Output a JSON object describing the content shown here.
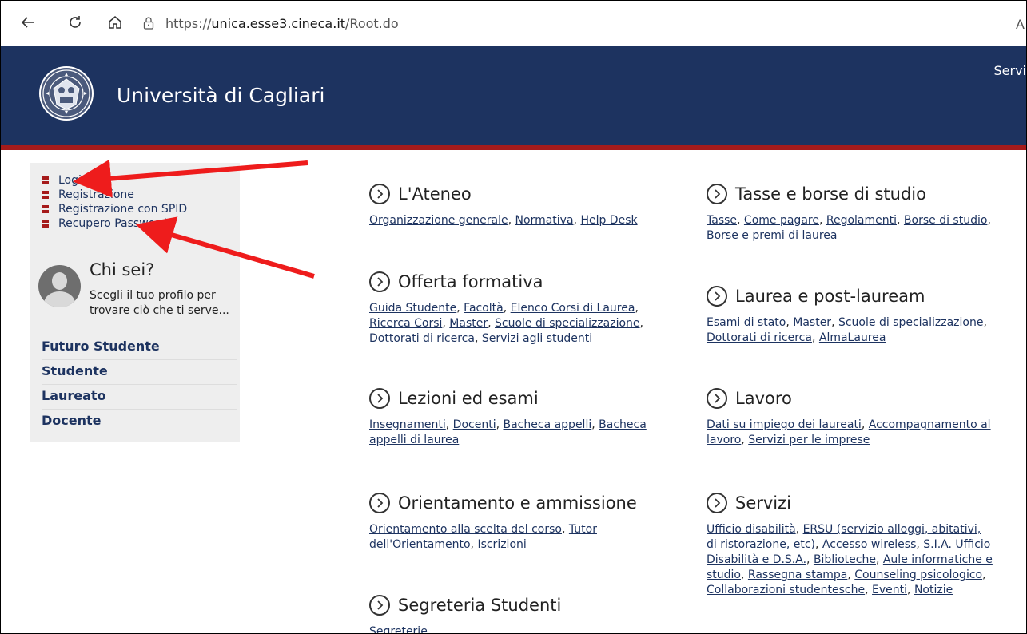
{
  "browser": {
    "url_prefix": "https://",
    "url_host": "unica.esse3.cineca.it",
    "url_path": "/Root.do",
    "cut_text": "A"
  },
  "header": {
    "brand": "Università di Cagliari",
    "nav_cut": "Servi"
  },
  "sidebar": {
    "links": [
      "Login",
      "Registrazione",
      "Registrazione con SPID",
      "Recupero Password"
    ],
    "chi_sei_title": "Chi sei?",
    "chi_sei_text": "Scegli il tuo profilo per trovare ciò che ti serve...",
    "profiles": [
      "Futuro Studente",
      "Studente",
      "Laureato",
      "Docente"
    ]
  },
  "sections": {
    "ateneo": {
      "title": "L'Ateneo",
      "links": [
        "Organizzazione generale",
        "Normativa",
        "Help Desk"
      ]
    },
    "offerta": {
      "title": "Offerta formativa",
      "links": [
        "Guida Studente",
        "Facoltà",
        "Elenco Corsi di Laurea",
        "Ricerca Corsi",
        "Master",
        "Scuole di specializzazione",
        "Dottorati di ricerca",
        "Servizi agli studenti"
      ]
    },
    "lezioni": {
      "title": "Lezioni ed esami",
      "links": [
        "Insegnamenti",
        "Docenti",
        "Bacheca appelli",
        "Bacheca appelli di laurea"
      ]
    },
    "orientamento": {
      "title": "Orientamento e ammissione",
      "links": [
        "Orientamento alla scelta del corso",
        "Tutor dell'Orientamento",
        "Iscrizioni"
      ]
    },
    "segreteria": {
      "title": "Segreteria Studenti",
      "links": [
        "Segreterie"
      ]
    },
    "tasse": {
      "title": "Tasse e borse di studio",
      "links": [
        "Tasse",
        "Come pagare",
        "Regolamenti",
        "Borse di studio",
        "Borse e premi di laurea"
      ]
    },
    "laurea": {
      "title": "Laurea e post-lauream",
      "links": [
        "Esami di stato",
        "Master",
        "Scuole di specializzazione",
        "Dottorati di ricerca",
        "AlmaLaurea"
      ]
    },
    "lavoro": {
      "title": "Lavoro",
      "links": [
        "Dati su impiego dei laureati",
        "Accompagnamento al lavoro",
        "Servizi per le imprese"
      ]
    },
    "servizi": {
      "title": "Servizi",
      "links": [
        "Ufficio disabilità",
        "ERSU (servizio alloggi, abitativi, di ristorazione, etc)",
        "Accesso wireless",
        "S.I.A. Ufficio Disabilità e D.S.A.",
        "Biblioteche",
        "Aule informatiche e studio",
        "Rassegna stampa",
        "Counseling psicologico",
        "Collaborazioni studentesche",
        "Eventi",
        "Notizie"
      ]
    }
  },
  "colors": {
    "header": "#1d3360",
    "accent_red": "#a51b1b",
    "sidebar_bg": "#eeeeee",
    "annotation_arrow": "#ee1c1c"
  }
}
